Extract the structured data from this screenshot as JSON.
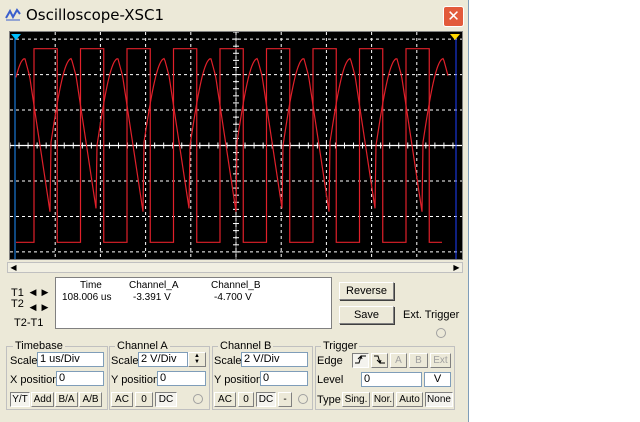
{
  "window": {
    "title": "Oscilloscope-XSC1",
    "close_glyph": "✕"
  },
  "scroll": {
    "left": "◀",
    "right": "▶"
  },
  "cursors": {
    "t1": "T1",
    "t2": "T2",
    "t2t1": "T2-T1",
    "left_arrow": "◀",
    "right_arrow": "▶",
    "t1_color": "#00bfff",
    "t2_color": "#ffd700"
  },
  "readout": {
    "col_time": "Time",
    "col_a": "Channel_A",
    "col_b": "Channel_B",
    "time": "108.006 us",
    "a": "-3.391 V",
    "b": "-4.700 V"
  },
  "buttons": {
    "reverse": "Reverse",
    "save": "Save",
    "ext_trigger": "Ext. Trigger"
  },
  "timebase": {
    "label": "Timebase",
    "scale_label": "Scale",
    "scale": "1 us/Div",
    "xpos_label": "X position",
    "xpos": "0",
    "modes": [
      "Y/T",
      "Add",
      "B/A",
      "A/B"
    ]
  },
  "channel_a": {
    "label": "Channel A",
    "scale_label": "Scale",
    "scale": "2  V/Div",
    "ypos_label": "Y position",
    "ypos": "0",
    "coupling": [
      "AC",
      "0",
      "DC"
    ]
  },
  "channel_b": {
    "label": "Channel B",
    "scale_label": "Scale",
    "scale": "2  V/Div",
    "ypos_label": "Y position",
    "ypos": "0",
    "coupling": [
      "AC",
      "0",
      "DC",
      "-"
    ]
  },
  "trigger": {
    "label": "Trigger",
    "edge_label": "Edge",
    "edge_a": "A",
    "edge_b": "B",
    "edge_ext": "Ext",
    "level_label": "Level",
    "level": "0",
    "level_unit": "V",
    "type_label": "Type",
    "types": [
      "Sing.",
      "Nor.",
      "Auto",
      "None"
    ]
  },
  "scope": {
    "background": "#000000",
    "trace_color": "#e0202a",
    "grid_color": "#ffffff",
    "channel_a_wave": "sawtooth-like, 9 cycles, peak about +4 V",
    "channel_b_wave": "square, 9 cycles, levels about +/-4.7 V"
  }
}
